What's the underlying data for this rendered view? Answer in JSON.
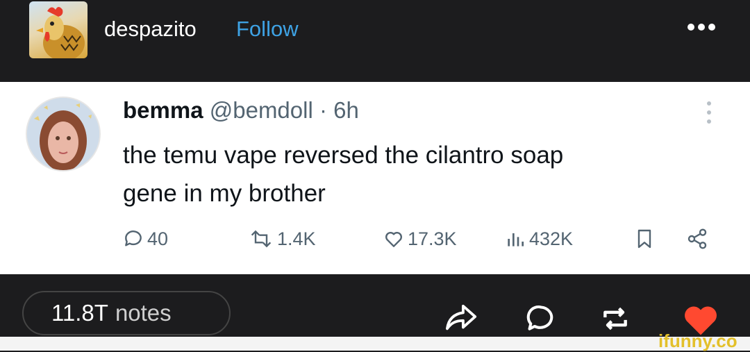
{
  "post": {
    "username": "despazito",
    "follow_label": "Follow"
  },
  "tweet": {
    "name": "bemma",
    "handle": "@bemdoll",
    "separator": "·",
    "time": "6h",
    "text_line1": "the temu vape reversed the cilantro soap",
    "text_line2": "gene in my brother",
    "stats": {
      "replies": "40",
      "retweets": "1.4K",
      "likes": "17.3K",
      "views": "432K"
    }
  },
  "footer": {
    "notes_count": "11.8T",
    "notes_label": "notes"
  },
  "watermark": "ifunny.co",
  "colors": {
    "background": "#1c1c1e",
    "follow_blue": "#3ea2e4",
    "tweet_bg": "#ffffff",
    "muted": "#536471",
    "like_red": "#ff4930",
    "watermark_yellow": "#e3c02b"
  },
  "icons": [
    "more-dots-icon",
    "reply-icon",
    "retweet-icon",
    "like-icon",
    "views-icon",
    "bookmark-icon",
    "share-icon",
    "kebab-icon",
    "share-arrow-icon",
    "comment-icon",
    "reblog-icon",
    "heart-icon"
  ]
}
